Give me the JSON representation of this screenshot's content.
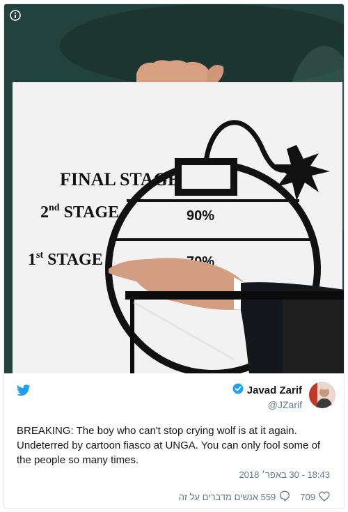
{
  "media": {
    "sign": {
      "final_stage": "FINAL STAGE",
      "second_stage_num": "2",
      "second_stage_sup": "nd",
      "second_stage_word": "STAGE",
      "first_stage_num": "1",
      "first_stage_sup": "st",
      "first_stage_word": "STAGE",
      "pct_second": "90%",
      "pct_first": "70%"
    },
    "info_icon": "info-icon"
  },
  "tweet": {
    "platform_icon": "twitter-bird-icon",
    "author": {
      "display_name": "Javad Zarif",
      "handle": "@JZarif",
      "verified_icon": "verified-badge-icon"
    },
    "text": "BREAKING: The boy who can't stop crying wolf is at it again. Undeterred by cartoon fiasco at UNGA. You can only fool some of the people so many times.",
    "timestamp": "18:43 - 30 באפר׳ 2018",
    "actions": {
      "likes_count": "709",
      "like_icon": "heart-icon",
      "replies_text": "559 אנשים מדברים על זה",
      "reply_icon": "speech-bubble-icon"
    }
  },
  "colors": {
    "twitter_blue": "#1da1f2",
    "verified_blue": "#1da1f2",
    "text_primary": "#14171a",
    "text_secondary": "#657786",
    "border": "#e1e8ed"
  }
}
